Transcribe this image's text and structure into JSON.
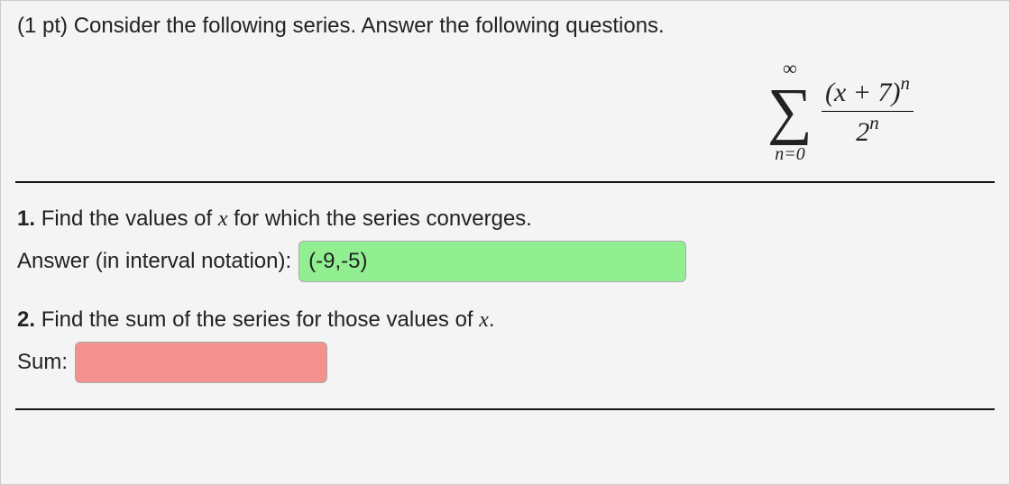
{
  "header": {
    "points": "(1 pt)",
    "prompt": "Consider the following series. Answer the following questions."
  },
  "formula": {
    "upper": "∞",
    "lower": "n=0",
    "numerator": "(x + 7)",
    "num_exp": "n",
    "denominator_base": "2",
    "den_exp": "n"
  },
  "q1": {
    "number": "1.",
    "text": "Find the values of ",
    "var": "x",
    "text2": " for which the series converges.",
    "answer_label": "Answer (in interval notation):",
    "answer_value": "(-9,-5)"
  },
  "q2": {
    "number": "2.",
    "text": "Find the sum of the series for those values of ",
    "var": "x",
    "text2": ".",
    "answer_label": "Sum:",
    "answer_value": ""
  }
}
